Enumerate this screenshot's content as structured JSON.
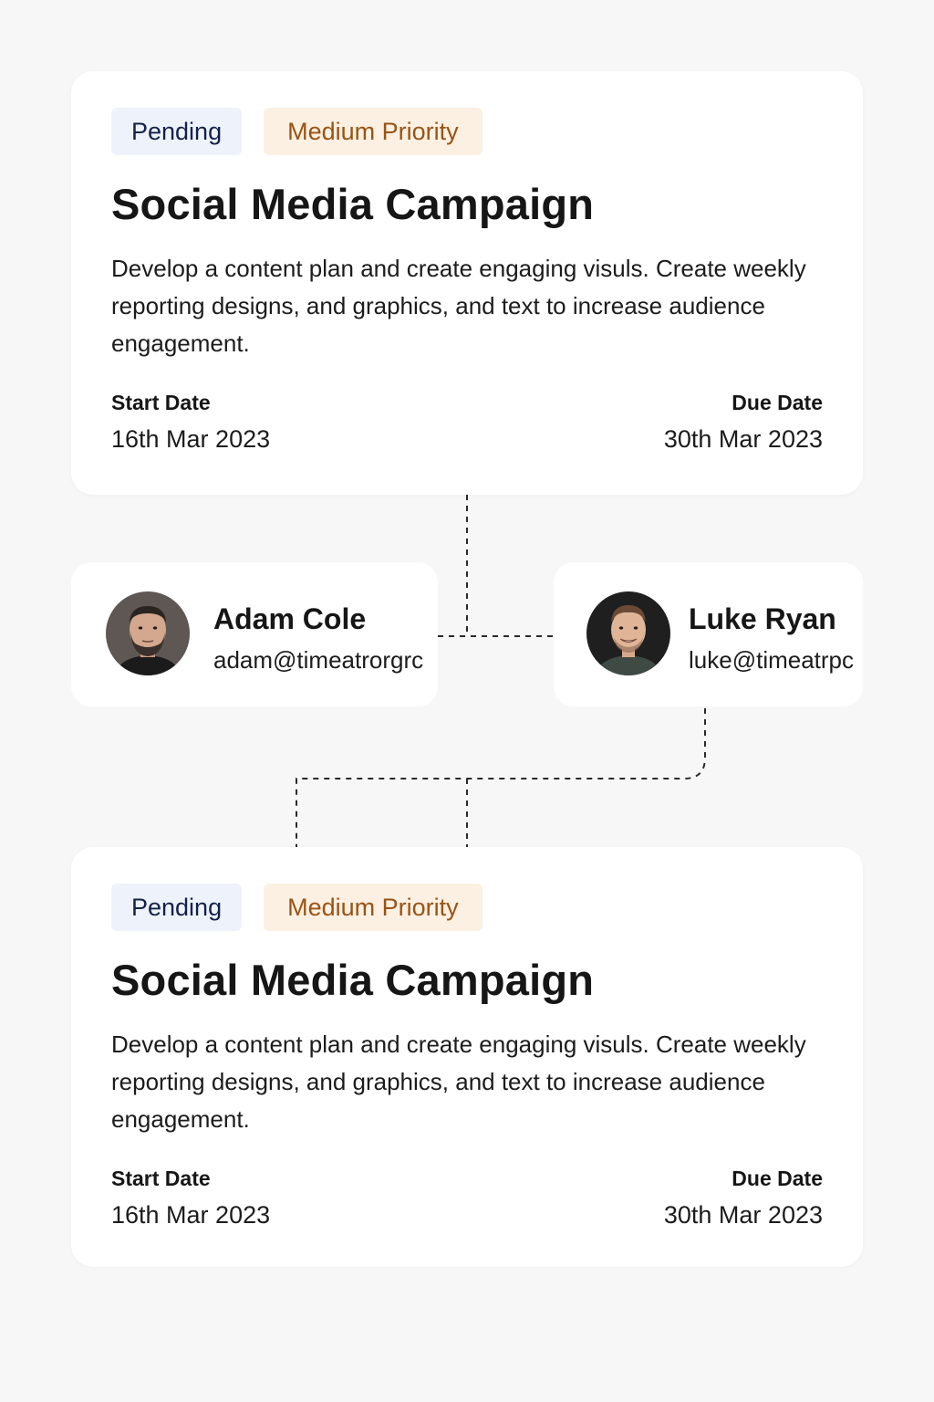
{
  "cards": [
    {
      "status": "Pending",
      "priority": "Medium Priority",
      "title": "Social Media Campaign",
      "description": "Develop a content plan and create engaging visuls. Create weekly reporting designs, and graphics, and text to increase audience engagement.",
      "start_label": "Start Date",
      "start_value": "16th Mar 2023",
      "due_label": "Due Date",
      "due_value": "30th Mar 2023"
    },
    {
      "status": "Pending",
      "priority": "Medium Priority",
      "title": "Social Media Campaign",
      "description": "Develop a content plan and create engaging visuls. Create weekly reporting designs, and graphics, and text to increase audience engagement.",
      "start_label": "Start Date",
      "start_value": "16th Mar 2023",
      "due_label": "Due Date",
      "due_value": "30th Mar 2023"
    }
  ],
  "people": [
    {
      "name": "Adam Cole",
      "email": "adam@timeatrorgrc",
      "avatar_icon": "bearded-man-avatar-icon"
    },
    {
      "name": "Luke Ryan",
      "email": "luke@timeatrpc",
      "avatar_icon": "smiling-man-avatar-icon"
    }
  ],
  "colors": {
    "background": "#f7f7f7",
    "card": "#ffffff",
    "status_bg": "#eef2fa",
    "status_text": "#13224a",
    "priority_bg": "#fcf0e2",
    "priority_text": "#9a5314"
  }
}
